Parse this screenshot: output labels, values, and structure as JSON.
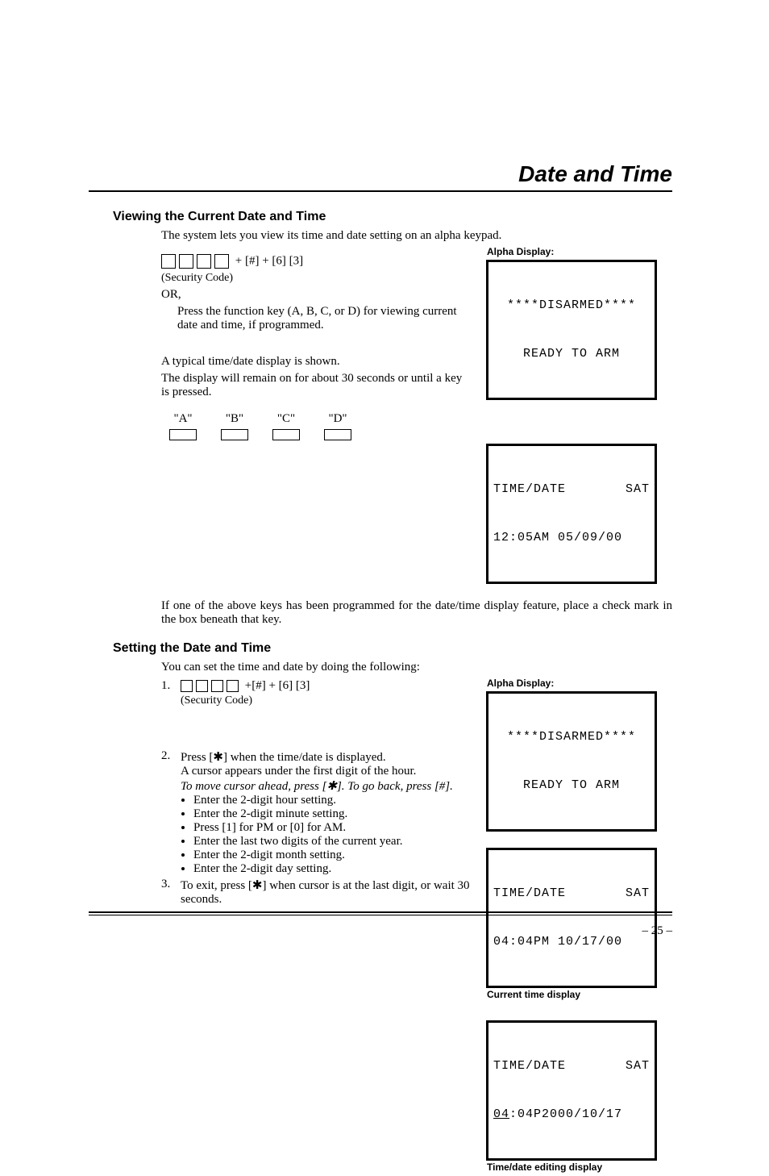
{
  "title": "Date and Time",
  "section1": {
    "heading": "Viewing the Current Date and Time",
    "intro": "The system lets you view its time and date setting on an alpha keypad.",
    "codeline_suffix": " + [#] + [6] [3]",
    "security_code_label": "(Security Code)",
    "or_label": "OR,",
    "press_fn": "Press the function key (A, B, C, or D) for viewing current date and time, if programmed.",
    "typical": "A typical time/date display is shown.",
    "remain": "The display will remain on for about 30 seconds or until a key is pressed.",
    "abcd": [
      "\"A\"",
      "\"B\"",
      "\"C\"",
      "\"D\""
    ],
    "abcd_note": "If one of the above keys has been programmed for the date/time display feature, place a check mark in the box beneath that key."
  },
  "alpha_label": "Alpha Display:",
  "lcd1": {
    "l1": "****DISARMED****",
    "l2": "READY TO ARM"
  },
  "lcd2": {
    "l1a": "TIME/DATE",
    "l1b": "SAT",
    "l2": "12:05AM 05/09/00"
  },
  "section2": {
    "heading": "Setting the Date and Time",
    "intro": "You can set the time and date by doing the following:",
    "step1_suffix": "+[#] +  [6] [3]",
    "security_code_label": "(Security Code)",
    "step2a": "Press [✱] when the time/date is displayed.",
    "step2b": "A cursor appears under the first digit of the hour.",
    "step2c": "To move cursor ahead, press [✱]. To go back, press [#].",
    "bullets": [
      "Enter the 2-digit hour setting.",
      "Enter the 2-digit minute setting.",
      "Press [1] for PM or [0] for AM.",
      "Enter the last two digits of the current year.",
      "Enter the 2-digit month setting.",
      "Enter the 2-digit day setting."
    ],
    "step3": "To exit, press [✱] when cursor is at the last digit, or wait 30 seconds."
  },
  "lcd3": {
    "l1": "****DISARMED****",
    "l2": "READY TO ARM"
  },
  "lcd4": {
    "l1a": "TIME/DATE",
    "l1b": "SAT",
    "l2": "04:04PM 10/17/00",
    "caption": "Current time display"
  },
  "lcd5": {
    "l1a": "TIME/DATE",
    "l1b": "SAT",
    "l2_pre": "04",
    "l2_post": ":04P2000/10/17",
    "caption": "Time/date editing display"
  },
  "page_no": "– 25 –"
}
